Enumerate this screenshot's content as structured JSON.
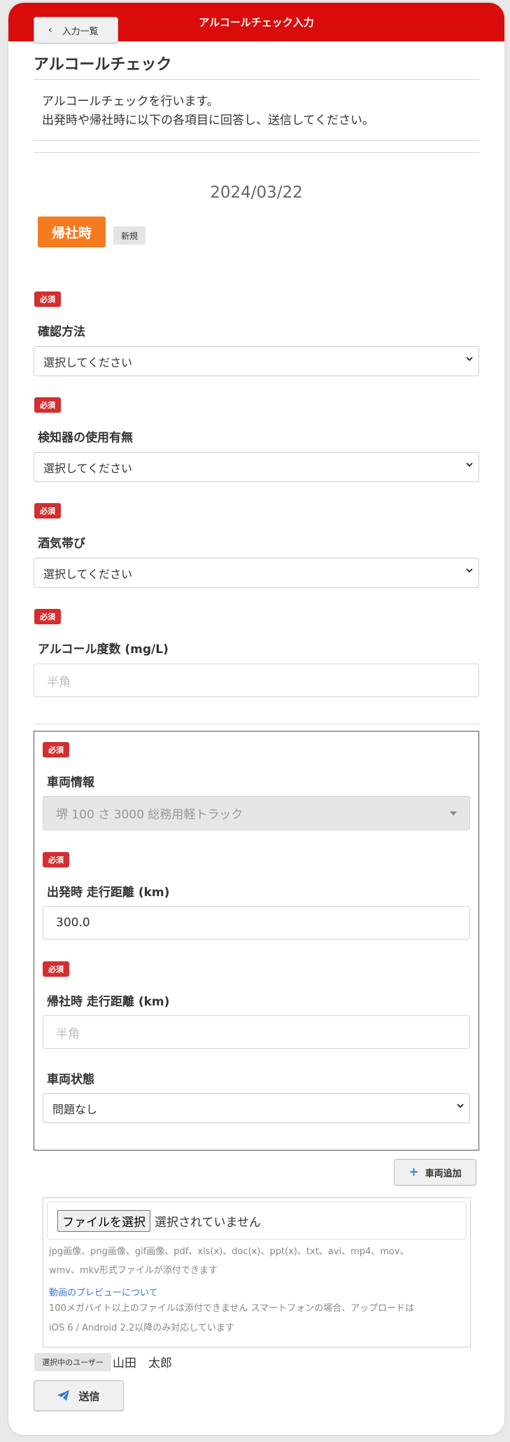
{
  "header": {
    "title": "アルコールチェック入力"
  },
  "nav": {
    "back_label": "入力一覧"
  },
  "page": {
    "title": "アルコールチェック",
    "description_line1": "アルコールチェックを行います。",
    "description_line2": "出発時や帰社時に以下の各項目に回答し、送信してください。",
    "date": "2024/03/22",
    "mode_label": "帰社時",
    "new_label": "新規"
  },
  "required_label": "必須",
  "fields": {
    "confirm_method": {
      "label": "確認方法",
      "value": "選択してください"
    },
    "detector_use": {
      "label": "検知器の使用有無",
      "value": "選択してください"
    },
    "alcohol_smell": {
      "label": "酒気帯び",
      "value": "選択してください"
    },
    "alcohol_level": {
      "label": "アルコール度数 (mg/L)",
      "placeholder": "半角"
    }
  },
  "vehicle": {
    "info_label": "車両情報",
    "info_value": "堺 100 さ 3000 総務用軽トラック",
    "depart_label": "出発時 走行距離 (km)",
    "depart_value": "300.0",
    "return_label": "帰社時 走行距離 (km)",
    "return_placeholder": "半角",
    "status_label": "車両状態",
    "status_value": "問題なし",
    "add_label": "車両追加"
  },
  "attachment": {
    "button_label": "ファイルを選択",
    "status": "選択されていません",
    "note_line1": "jpg画像、png画像、gif画像、pdf、xls(x)、doc(x)、ppt(x)、txt、avi、mp4、mov、",
    "note_line2": "wmv、mkv形式ファイルが添付できます",
    "preview_link": "動画のプレビューについて",
    "note_line3": "100メガバイト以上のファイルは添付できません スマートフォンの場合、アップロードは",
    "note_line4": "iOS 6 / Android 2.2以降のみ対応しています"
  },
  "user": {
    "label": "選択中のユーザー",
    "name": "山田　太郎"
  },
  "submit": {
    "label": "送信"
  },
  "colors": {
    "header": "#d90b0b",
    "mode_badge": "#f47b20",
    "required_badge": "#d42e2e",
    "link": "#3a7bc8"
  }
}
